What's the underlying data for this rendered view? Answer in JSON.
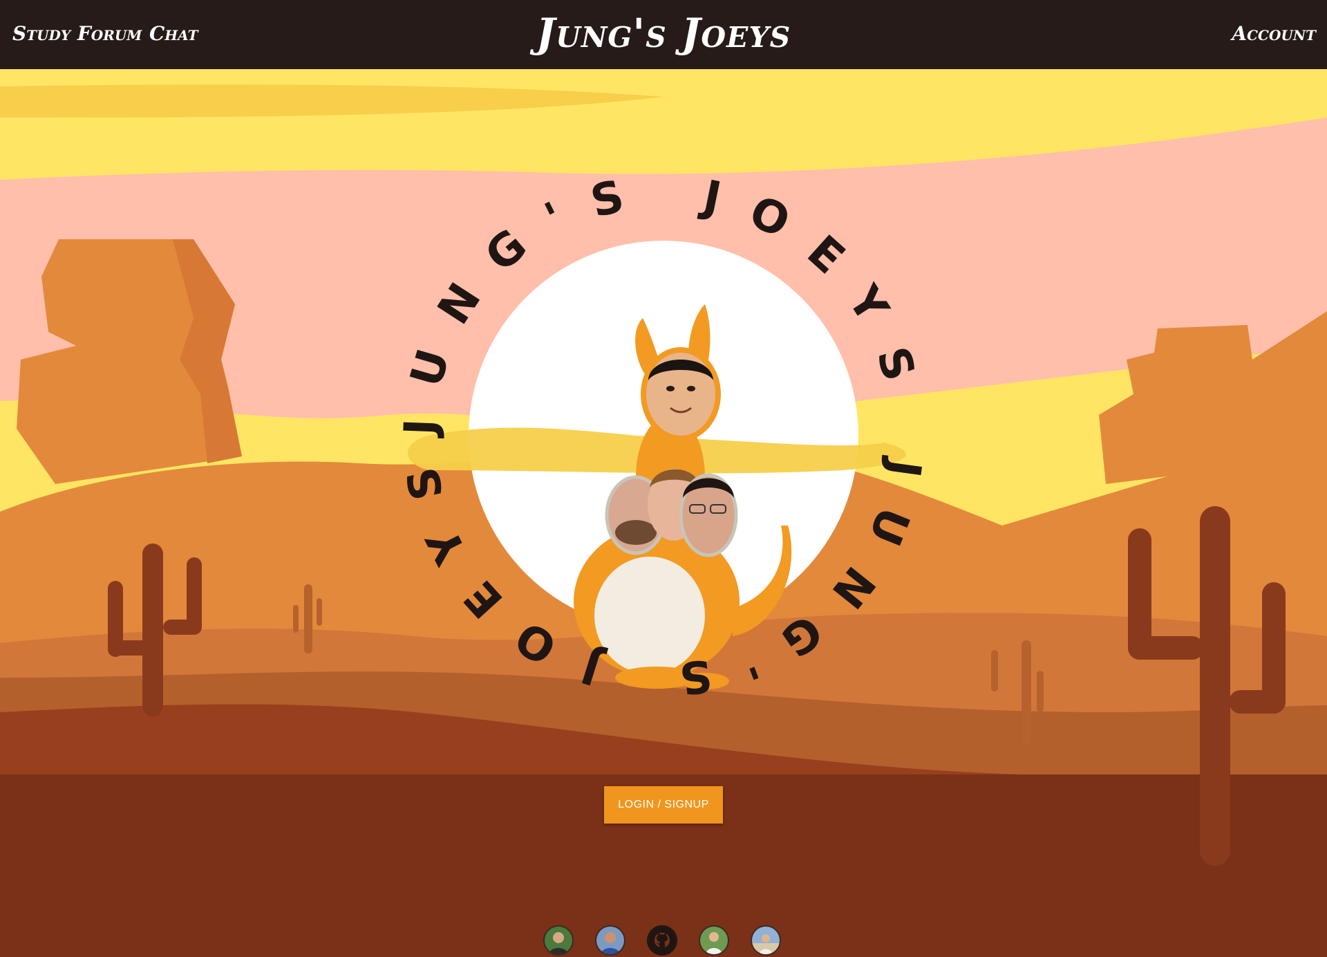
{
  "nav": {
    "study_forum": "Study Forum",
    "chat": "Chat",
    "title": "Jung's Joeys",
    "account": "Account"
  },
  "logo": {
    "ring_text": "JUNG'S JOEYS JUNG'S JOEYS",
    "center_image": "kangaroo-with-faces"
  },
  "main": {
    "login_label": "LOGIN / SIGNUP"
  },
  "footer": {
    "links": [
      {
        "name": "team-avatar-1"
      },
      {
        "name": "team-avatar-2"
      },
      {
        "name": "github-icon"
      },
      {
        "name": "team-avatar-3"
      },
      {
        "name": "team-avatar-4"
      }
    ]
  },
  "colors": {
    "nav_bg": "#261b19",
    "sky_yellow": "#ffe563",
    "sky_pink": "#ffbfaa",
    "sand_orange": "#e3893c",
    "ground_dark": "#7a3118",
    "button": "#f0961e",
    "cactus": "#8a3a1c"
  }
}
